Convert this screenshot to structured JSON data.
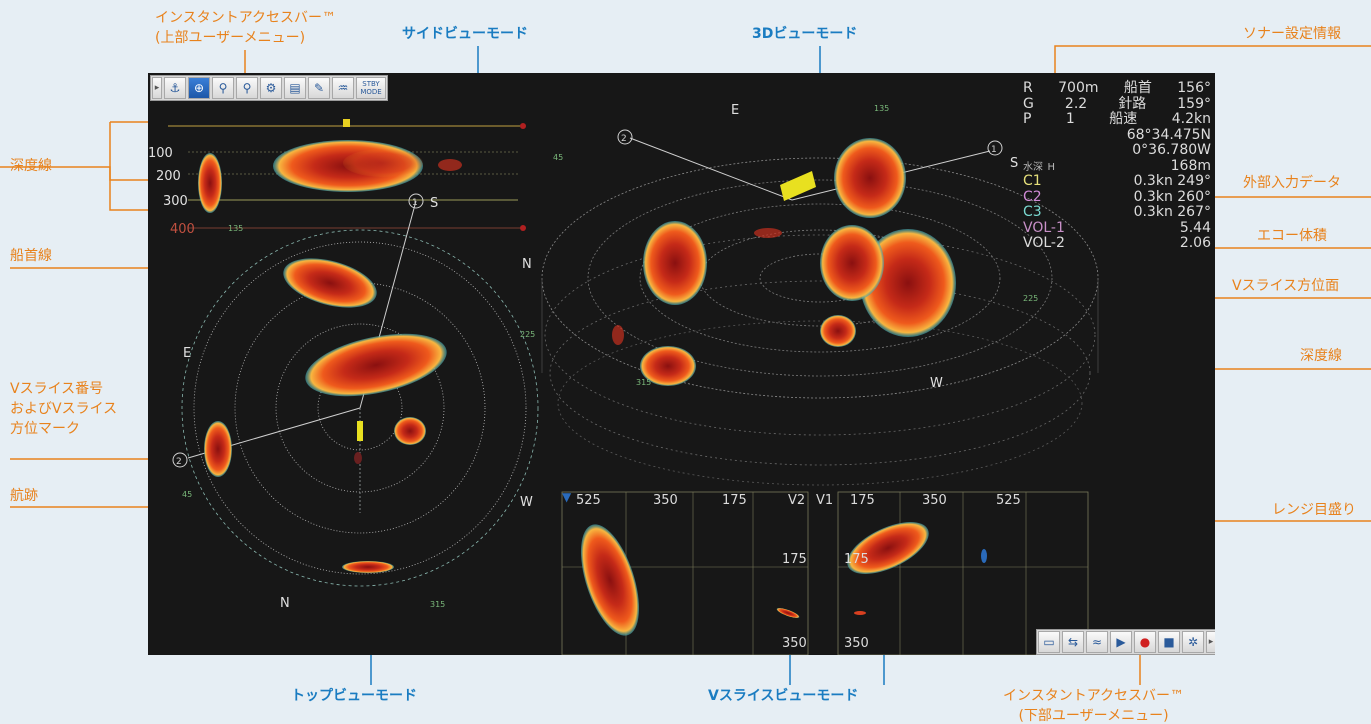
{
  "labels": {
    "instant_bar_top_1": "インスタントアクセスバー™",
    "instant_bar_top_2": "(上部ユーザーメニュー)",
    "side_view": "サイドビューモード",
    "view_3d": "3Dビューモード",
    "sonar_settings": "ソナー設定情報",
    "depth_line_left": "深度線",
    "external_input": "外部入力データ",
    "echo_volume": "エコー体積",
    "vslice_bearing": "Vスライス方位面",
    "heading_line": "船首線",
    "depth_line_right": "深度線",
    "vslice_number_1": "Vスライス番号",
    "vslice_number_2": "およびVスライス",
    "vslice_number_3": "方位マーク",
    "track": "航跡",
    "range_scale": "レンジ目盛り",
    "top_view": "トップビューモード",
    "vslice_view": "Vスライスビューモード",
    "instant_bar_bottom_1": "インスタントアクセスバー™",
    "instant_bar_bottom_2": "(下部ユーザーメニュー)"
  },
  "toolbar_top": {
    "buttons": [
      {
        "icon": "expand-arrow-icon",
        "glyph": "▸"
      },
      {
        "icon": "ship-echo-icon",
        "glyph": "⚓"
      },
      {
        "icon": "target-lock-icon",
        "glyph": "⊕"
      },
      {
        "icon": "zoom-1-icon",
        "glyph": "⚲"
      },
      {
        "icon": "zoom-2-icon",
        "glyph": "⚲"
      },
      {
        "icon": "gear-target-icon",
        "glyph": "⚙"
      },
      {
        "icon": "database-icon",
        "glyph": "▤"
      },
      {
        "icon": "brush-icon",
        "glyph": "✎"
      },
      {
        "icon": "fish-school-icon",
        "glyph": "♒"
      },
      {
        "icon": "mode-text-icon",
        "glyph": "STBY MODE"
      }
    ]
  },
  "toolbar_bottom": {
    "buttons": [
      {
        "icon": "monitor-icon",
        "glyph": "▭"
      },
      {
        "icon": "swap-icon",
        "glyph": "⇆"
      },
      {
        "icon": "echo-off-icon",
        "glyph": "≈"
      },
      {
        "icon": "play-icon",
        "glyph": "▶"
      },
      {
        "icon": "record-icon",
        "glyph": "●"
      },
      {
        "icon": "stop-icon",
        "glyph": "■"
      },
      {
        "icon": "settings-icon",
        "glyph": "✲"
      },
      {
        "icon": "more-icon",
        "glyph": "▸"
      }
    ]
  },
  "sonar_info": {
    "r_label": "R",
    "r_value": "700m",
    "heading_label": "船首",
    "heading_value": "156°",
    "g_label": "G",
    "g_value": "2.2",
    "course_label": "針路",
    "course_value": "159°",
    "p_label": "P",
    "p_value": "1",
    "speed_label": "船速",
    "speed_value": "4.2kn",
    "lat": "68°34.475N",
    "lon": "0°36.780W",
    "depth_label": "水深",
    "depth_h": "H",
    "depth_value": "168m",
    "c1_label": "C1",
    "c1_value": "0.3kn 249°",
    "c2_label": "C2",
    "c2_value": "0.3kn 260°",
    "c3_label": "C3",
    "c3_value": "0.3kn 267°",
    "vol1_label": "VOL-1",
    "vol1_value": "5.44",
    "vol2_label": "VOL-2",
    "vol2_value": "2.06"
  },
  "side_view": {
    "depths": [
      "100",
      "200",
      "300",
      "400"
    ]
  },
  "top_view": {
    "compass": {
      "E": "E",
      "S": "S",
      "W": "W",
      "N": "N"
    },
    "bearings": {
      "b135": "135",
      "b225": "225",
      "b315": "315",
      "b45": "45"
    },
    "marker1": "1",
    "marker2": "2"
  },
  "view3d": {
    "compass": {
      "E": "E",
      "S": "S",
      "W": "W",
      "N": "N"
    },
    "bearings": {
      "b135": "135",
      "b45": "45",
      "b225": "225",
      "b315": "315"
    },
    "marker1": "1",
    "marker2": "2"
  },
  "vslice": {
    "left_ticks": [
      "525",
      "350",
      "175"
    ],
    "left_label": "V2",
    "right_label": "V1",
    "right_ticks": [
      "175",
      "350",
      "525"
    ],
    "depth_ticks": [
      "175",
      "350"
    ]
  },
  "colors": {
    "accent_orange": "#e8821c",
    "accent_blue": "#1a7cc1",
    "screen_bg": "#171717",
    "echo_red": "#d7301c"
  }
}
